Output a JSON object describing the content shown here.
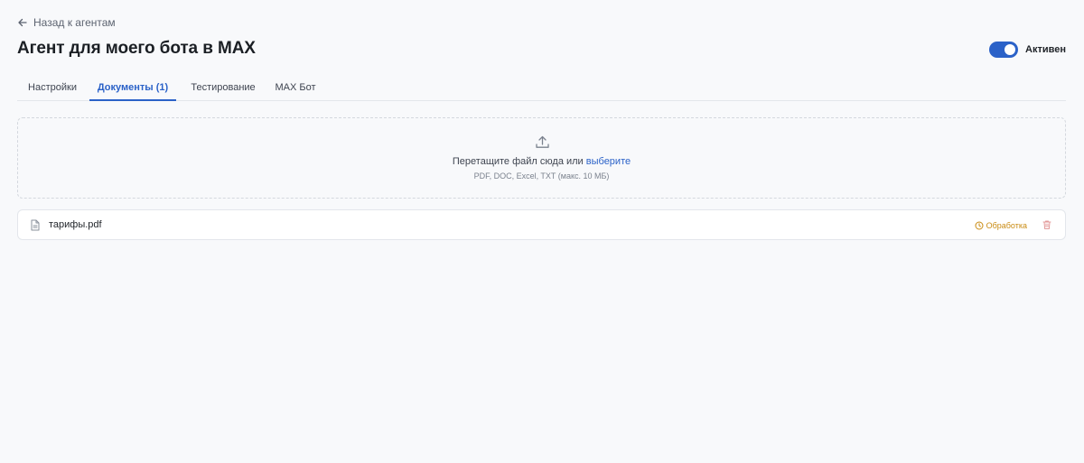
{
  "nav": {
    "back_label": "Назад к агентам"
  },
  "header": {
    "title": "Агент для моего бота в MAX",
    "status_label": "Активен",
    "active": true,
    "accent_color": "#2b62c8"
  },
  "tabs": [
    {
      "label": "Настройки",
      "active": false
    },
    {
      "label": "Документы (1)",
      "active": true
    },
    {
      "label": "Тестирование",
      "active": false
    },
    {
      "label": "MAX Бот",
      "active": false
    }
  ],
  "upload": {
    "icon": "upload-icon",
    "text": "Перетащите файл сюда или",
    "link": "выберите",
    "hint": "PDF, DOC, Excel, TXT (макс. 10 МБ)"
  },
  "files": [
    {
      "name": "тарифы.pdf",
      "icon": "file-icon",
      "status": "Обработка",
      "status_color": "#c98b12",
      "delete_icon": "trash-icon"
    }
  ]
}
